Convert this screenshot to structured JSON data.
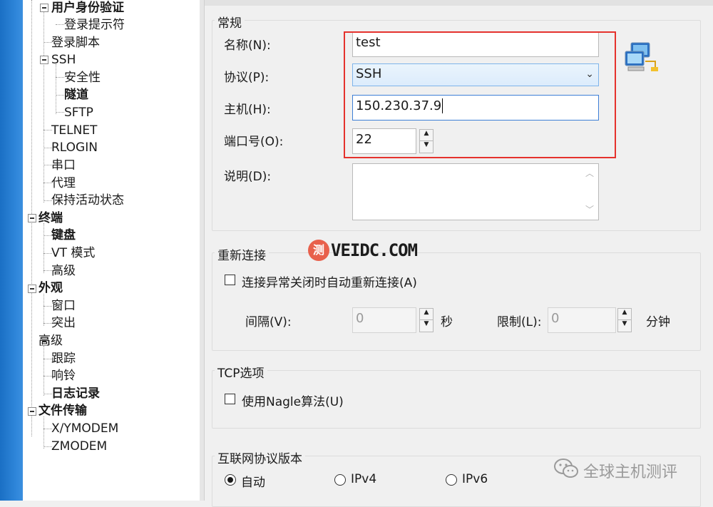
{
  "tree": {
    "items": [
      {
        "label": "用户身份验证",
        "bold": true
      },
      {
        "label": "登录提示符",
        "bold": false
      },
      {
        "label": "登录脚本",
        "bold": false
      },
      {
        "label": "SSH",
        "bold": false
      },
      {
        "label": "安全性",
        "bold": false
      },
      {
        "label": "隧道",
        "bold": true
      },
      {
        "label": "SFTP",
        "bold": false
      },
      {
        "label": "TELNET",
        "bold": false
      },
      {
        "label": "RLOGIN",
        "bold": false
      },
      {
        "label": "串口",
        "bold": false
      },
      {
        "label": "代理",
        "bold": false
      },
      {
        "label": "保持活动状态",
        "bold": false
      },
      {
        "label": "终端",
        "bold": true
      },
      {
        "label": "键盘",
        "bold": true
      },
      {
        "label": "VT 模式",
        "bold": false
      },
      {
        "label": "高级",
        "bold": false
      },
      {
        "label": "外观",
        "bold": true
      },
      {
        "label": "窗口",
        "bold": false
      },
      {
        "label": "突出",
        "bold": false
      },
      {
        "label": "高级",
        "bold": false
      },
      {
        "label": "跟踪",
        "bold": false
      },
      {
        "label": "响铃",
        "bold": false
      },
      {
        "label": "日志记录",
        "bold": true
      },
      {
        "label": "文件传输",
        "bold": true
      },
      {
        "label": "X/YMODEM",
        "bold": false
      },
      {
        "label": "ZMODEM",
        "bold": false
      }
    ]
  },
  "general": {
    "title": "常规",
    "name_label": "名称(N):",
    "name_value": "test",
    "protocol_label": "协议(P):",
    "protocol_value": "SSH",
    "host_label": "主机(H):",
    "host_value": "150.230.37.9",
    "port_label": "端口号(O):",
    "port_value": "22",
    "desc_label": "说明(D):",
    "desc_value": ""
  },
  "reconnect": {
    "title": "重新连接",
    "checkbox_label": "连接异常关闭时自动重新连接(A)",
    "checked": false,
    "interval_label": "间隔(V):",
    "interval_value": "0",
    "interval_unit": "秒",
    "limit_label": "限制(L):",
    "limit_value": "0",
    "limit_unit": "分钟"
  },
  "tcp": {
    "title": "TCP选项",
    "nagle_label": "使用Nagle算法(U)",
    "checked": false
  },
  "ip_version": {
    "title": "互联网协议版本",
    "options": [
      "自动",
      "IPv4",
      "IPv6"
    ],
    "selected": "自动"
  },
  "watermark": {
    "site": "VEIDC.COM",
    "badge": "测",
    "wechat": "全球主机测评"
  },
  "colors": {
    "highlight": "#e5322d",
    "desktop": "#2f86da"
  }
}
